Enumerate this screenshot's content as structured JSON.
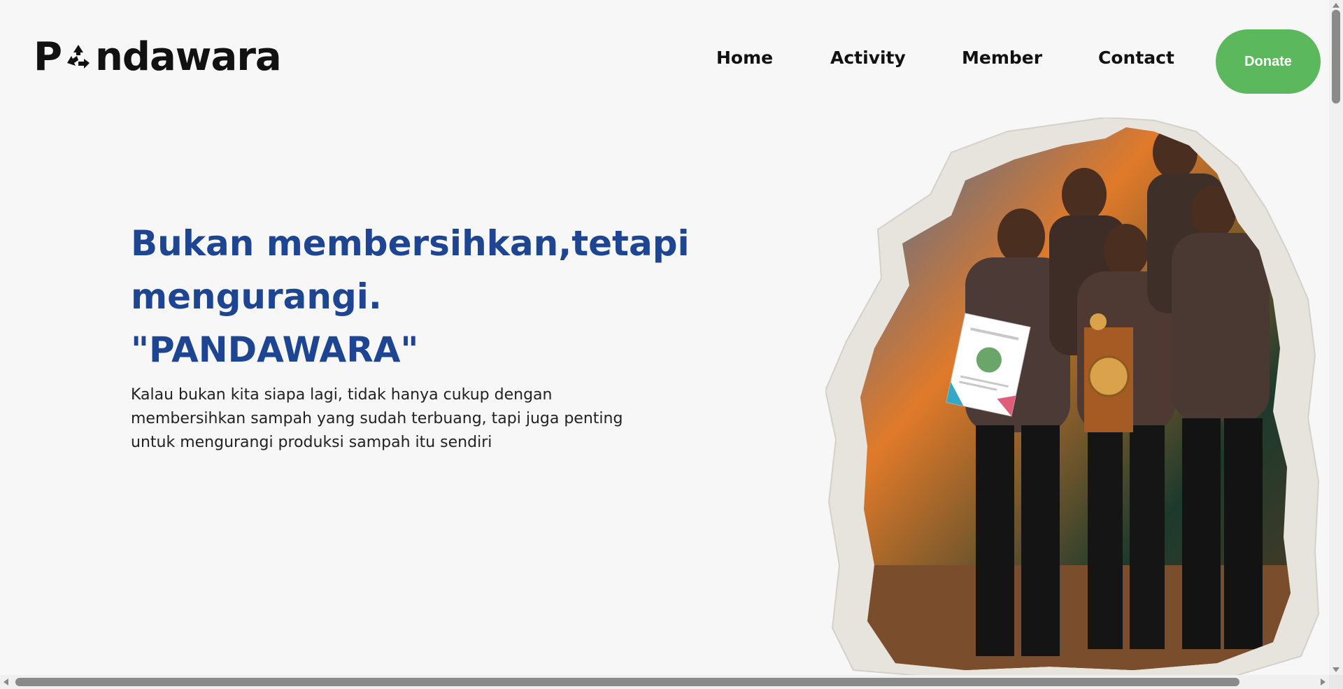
{
  "brand": {
    "logo_text_left": "P",
    "logo_icon": "recycle-icon",
    "logo_text_right": "ndawara"
  },
  "nav": {
    "items": [
      {
        "label": "Home"
      },
      {
        "label": "Activity"
      },
      {
        "label": "Member"
      },
      {
        "label": "Contact"
      }
    ],
    "donate_label": "Donate"
  },
  "hero": {
    "title_line1": "Bukan membersihkan,tetapi",
    "title_line2": "mengurangi.",
    "title_line3": "\"PANDAWARA\"",
    "description": "Kalau bukan kita siapa lagi, tidak hanya cukup dengan membersihkan sampah yang sudah terbuang, tapi juga penting untuk mengurangi produksi sampah itu sendiri"
  },
  "colors": {
    "title": "#1d4592",
    "donate": "#5cb85c",
    "background": "#f7f7f7"
  }
}
